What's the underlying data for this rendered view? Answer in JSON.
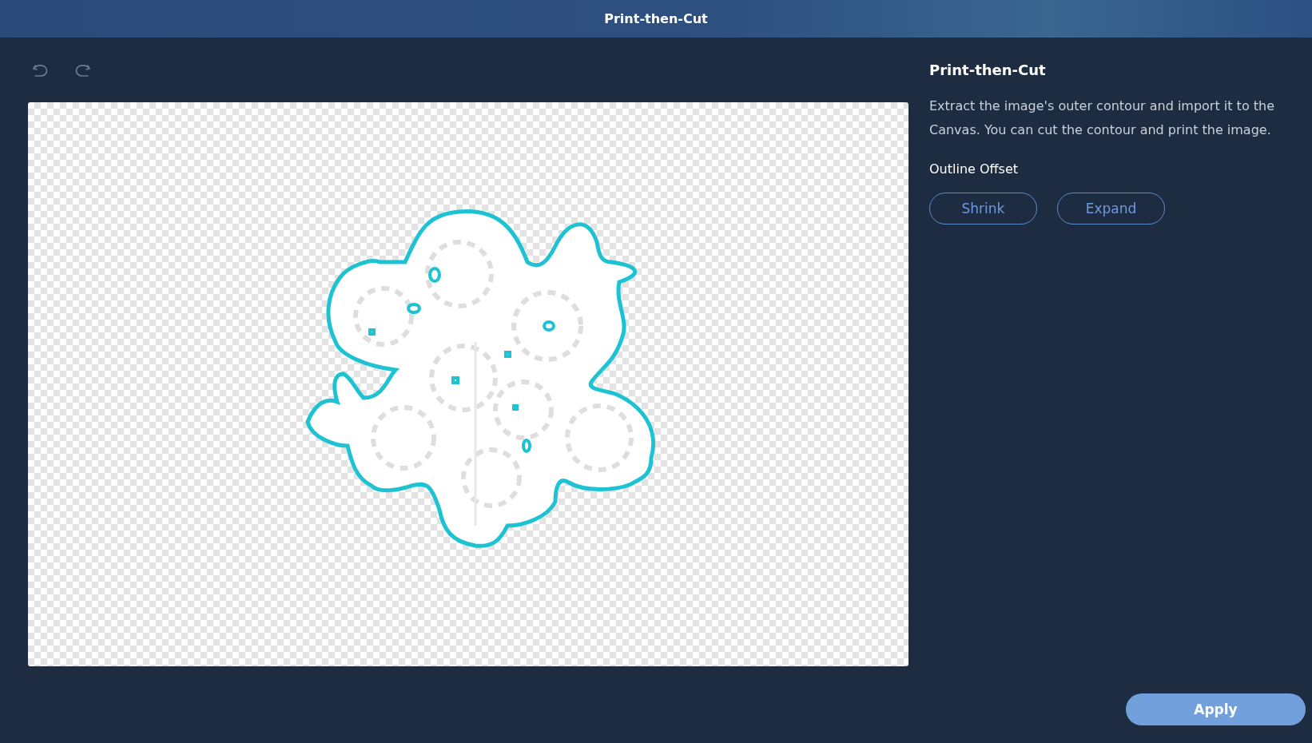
{
  "window": {
    "title": "Print-then-Cut"
  },
  "panel": {
    "heading": "Print-then-Cut",
    "description": "Extract the image's outer contour and import it to the Canvas. You can cut the contour and print the image.",
    "offset_label": "Outline Offset",
    "offset_buttons": [
      "Shrink",
      "Expand"
    ]
  },
  "apply_button": "Apply"
}
